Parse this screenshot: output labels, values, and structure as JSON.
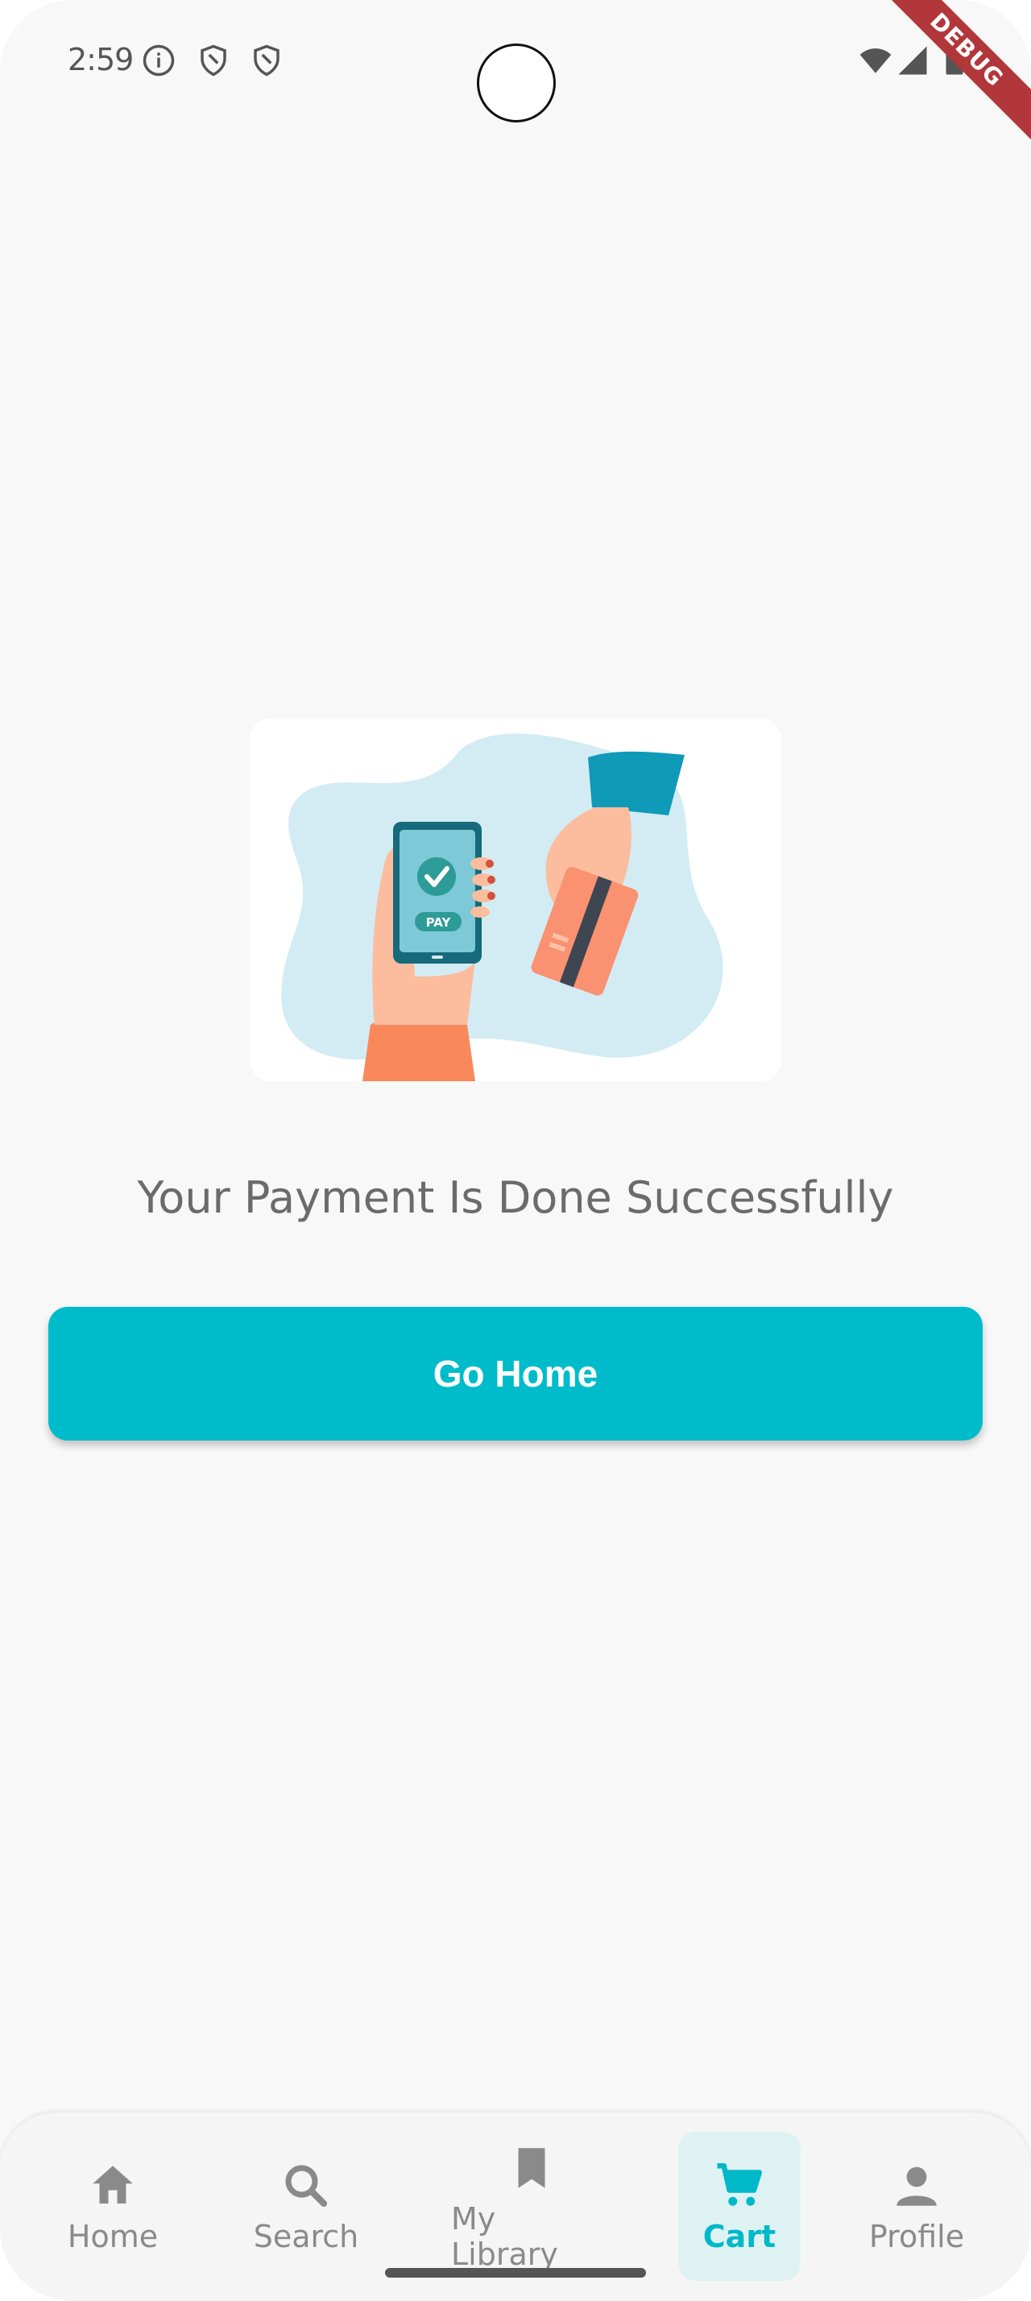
{
  "status_bar": {
    "time": "2:59",
    "icons": [
      "info-icon",
      "shield-icon",
      "shield-icon",
      "wifi-icon",
      "signal-icon",
      "battery-icon"
    ],
    "debug_label": "DEBUG"
  },
  "main": {
    "message": "Your Payment Is Done Successfully",
    "button_label": "Go Home",
    "illustration_text": "PAY"
  },
  "bottom_nav": {
    "items": [
      {
        "label": "Home",
        "icon": "home-icon"
      },
      {
        "label": "Search",
        "icon": "search-icon"
      },
      {
        "label": "My Library",
        "icon": "bookmark-icon"
      },
      {
        "label": "Cart",
        "icon": "cart-icon"
      },
      {
        "label": "Profile",
        "icon": "person-icon"
      }
    ],
    "active_index": 3
  },
  "colors": {
    "accent": "#00bcca",
    "background": "#f8f8f8",
    "text_muted": "#6b6b6b"
  }
}
